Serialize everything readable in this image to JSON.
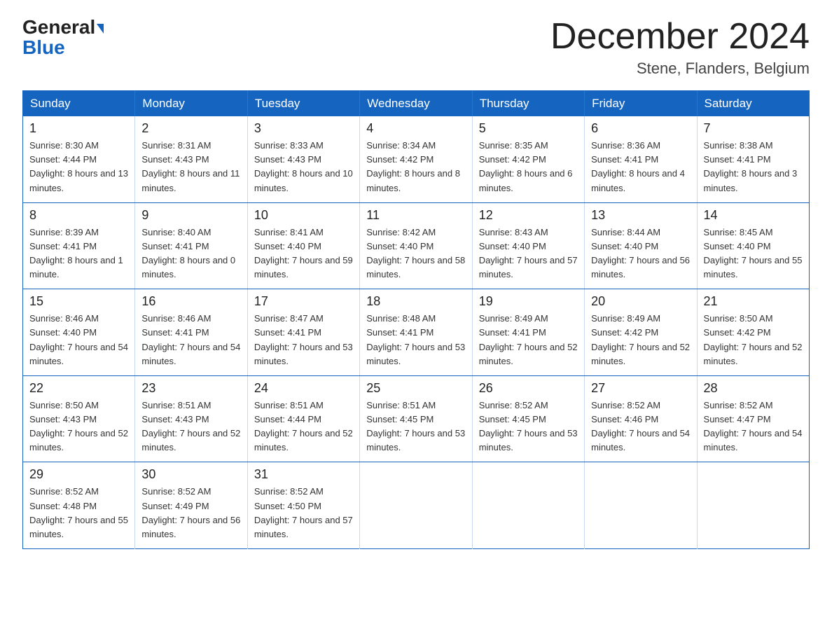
{
  "logo": {
    "line1": "General",
    "line2": "Blue"
  },
  "title": "December 2024",
  "subtitle": "Stene, Flanders, Belgium",
  "days_of_week": [
    "Sunday",
    "Monday",
    "Tuesday",
    "Wednesday",
    "Thursday",
    "Friday",
    "Saturday"
  ],
  "weeks": [
    [
      {
        "day": "1",
        "sunrise": "8:30 AM",
        "sunset": "4:44 PM",
        "daylight": "8 hours and 13 minutes."
      },
      {
        "day": "2",
        "sunrise": "8:31 AM",
        "sunset": "4:43 PM",
        "daylight": "8 hours and 11 minutes."
      },
      {
        "day": "3",
        "sunrise": "8:33 AM",
        "sunset": "4:43 PM",
        "daylight": "8 hours and 10 minutes."
      },
      {
        "day": "4",
        "sunrise": "8:34 AM",
        "sunset": "4:42 PM",
        "daylight": "8 hours and 8 minutes."
      },
      {
        "day": "5",
        "sunrise": "8:35 AM",
        "sunset": "4:42 PM",
        "daylight": "8 hours and 6 minutes."
      },
      {
        "day": "6",
        "sunrise": "8:36 AM",
        "sunset": "4:41 PM",
        "daylight": "8 hours and 4 minutes."
      },
      {
        "day": "7",
        "sunrise": "8:38 AM",
        "sunset": "4:41 PM",
        "daylight": "8 hours and 3 minutes."
      }
    ],
    [
      {
        "day": "8",
        "sunrise": "8:39 AM",
        "sunset": "4:41 PM",
        "daylight": "8 hours and 1 minute."
      },
      {
        "day": "9",
        "sunrise": "8:40 AM",
        "sunset": "4:41 PM",
        "daylight": "8 hours and 0 minutes."
      },
      {
        "day": "10",
        "sunrise": "8:41 AM",
        "sunset": "4:40 PM",
        "daylight": "7 hours and 59 minutes."
      },
      {
        "day": "11",
        "sunrise": "8:42 AM",
        "sunset": "4:40 PM",
        "daylight": "7 hours and 58 minutes."
      },
      {
        "day": "12",
        "sunrise": "8:43 AM",
        "sunset": "4:40 PM",
        "daylight": "7 hours and 57 minutes."
      },
      {
        "day": "13",
        "sunrise": "8:44 AM",
        "sunset": "4:40 PM",
        "daylight": "7 hours and 56 minutes."
      },
      {
        "day": "14",
        "sunrise": "8:45 AM",
        "sunset": "4:40 PM",
        "daylight": "7 hours and 55 minutes."
      }
    ],
    [
      {
        "day": "15",
        "sunrise": "8:46 AM",
        "sunset": "4:40 PM",
        "daylight": "7 hours and 54 minutes."
      },
      {
        "day": "16",
        "sunrise": "8:46 AM",
        "sunset": "4:41 PM",
        "daylight": "7 hours and 54 minutes."
      },
      {
        "day": "17",
        "sunrise": "8:47 AM",
        "sunset": "4:41 PM",
        "daylight": "7 hours and 53 minutes."
      },
      {
        "day": "18",
        "sunrise": "8:48 AM",
        "sunset": "4:41 PM",
        "daylight": "7 hours and 53 minutes."
      },
      {
        "day": "19",
        "sunrise": "8:49 AM",
        "sunset": "4:41 PM",
        "daylight": "7 hours and 52 minutes."
      },
      {
        "day": "20",
        "sunrise": "8:49 AM",
        "sunset": "4:42 PM",
        "daylight": "7 hours and 52 minutes."
      },
      {
        "day": "21",
        "sunrise": "8:50 AM",
        "sunset": "4:42 PM",
        "daylight": "7 hours and 52 minutes."
      }
    ],
    [
      {
        "day": "22",
        "sunrise": "8:50 AM",
        "sunset": "4:43 PM",
        "daylight": "7 hours and 52 minutes."
      },
      {
        "day": "23",
        "sunrise": "8:51 AM",
        "sunset": "4:43 PM",
        "daylight": "7 hours and 52 minutes."
      },
      {
        "day": "24",
        "sunrise": "8:51 AM",
        "sunset": "4:44 PM",
        "daylight": "7 hours and 52 minutes."
      },
      {
        "day": "25",
        "sunrise": "8:51 AM",
        "sunset": "4:45 PM",
        "daylight": "7 hours and 53 minutes."
      },
      {
        "day": "26",
        "sunrise": "8:52 AM",
        "sunset": "4:45 PM",
        "daylight": "7 hours and 53 minutes."
      },
      {
        "day": "27",
        "sunrise": "8:52 AM",
        "sunset": "4:46 PM",
        "daylight": "7 hours and 54 minutes."
      },
      {
        "day": "28",
        "sunrise": "8:52 AM",
        "sunset": "4:47 PM",
        "daylight": "7 hours and 54 minutes."
      }
    ],
    [
      {
        "day": "29",
        "sunrise": "8:52 AM",
        "sunset": "4:48 PM",
        "daylight": "7 hours and 55 minutes."
      },
      {
        "day": "30",
        "sunrise": "8:52 AM",
        "sunset": "4:49 PM",
        "daylight": "7 hours and 56 minutes."
      },
      {
        "day": "31",
        "sunrise": "8:52 AM",
        "sunset": "4:50 PM",
        "daylight": "7 hours and 57 minutes."
      },
      null,
      null,
      null,
      null
    ]
  ]
}
